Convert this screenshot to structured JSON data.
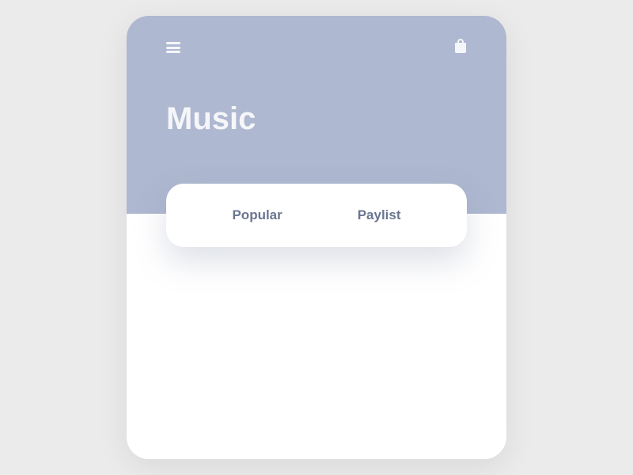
{
  "header": {
    "title": "Music"
  },
  "tabs": {
    "popular": "Popular",
    "playlist": "Paylist"
  },
  "colors": {
    "headerBg": "#aeb8d0",
    "pageBg": "#ebebeb",
    "cardBg": "#ffffff",
    "iconColor": "#f5f6f9",
    "tabText": "#6b7591"
  }
}
